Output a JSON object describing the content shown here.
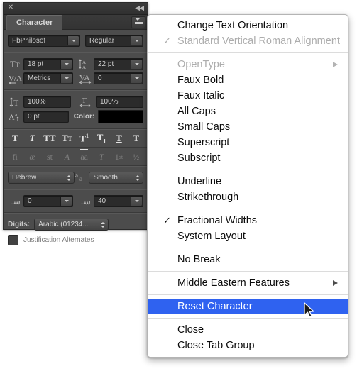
{
  "panel": {
    "title": "Character",
    "close_icon": "close-icon",
    "collapse_icon": "collapse-panel-icon",
    "menu_icon": "panel-menu-icon",
    "font": {
      "family": "FbPhilosof",
      "style": "Regular"
    },
    "size": {
      "icon": "font-size-icon",
      "value": "18 pt"
    },
    "leading": {
      "icon": "leading-icon",
      "value": "22 pt"
    },
    "kerning": {
      "icon": "kerning-icon",
      "value": "Metrics"
    },
    "tracking": {
      "icon": "tracking-icon",
      "value": "0"
    },
    "vertical_scale": {
      "icon": "vertical-scale-icon",
      "value": "100%"
    },
    "horizontal_scale": {
      "icon": "horizontal-scale-icon",
      "value": "100%"
    },
    "baseline_shift": {
      "icon": "baseline-shift-icon",
      "value": "0 pt"
    },
    "color": {
      "label": "Color:",
      "value": "#000000"
    },
    "style_buttons": [
      {
        "name": "faux-bold-button",
        "glyph": "T",
        "enabled": true
      },
      {
        "name": "faux-italic-button",
        "glyph": "T",
        "enabled": true
      },
      {
        "name": "all-caps-button",
        "glyph": "TT",
        "enabled": true
      },
      {
        "name": "small-caps-button",
        "glyph": "TT",
        "enabled": true
      },
      {
        "name": "superscript-button",
        "glyph": "T1",
        "enabled": true
      },
      {
        "name": "subscript-button",
        "glyph": "T1",
        "enabled": true
      },
      {
        "name": "underline-button",
        "glyph": "T",
        "enabled": true
      },
      {
        "name": "strikethrough-button",
        "glyph": "T",
        "enabled": true
      }
    ],
    "opentype_buttons": [
      {
        "name": "standard-ligatures-button",
        "glyph": "fi",
        "enabled": false
      },
      {
        "name": "contextual-alternates-button",
        "glyph": "œ",
        "enabled": false
      },
      {
        "name": "discretionary-ligatures-button",
        "glyph": "st",
        "enabled": false
      },
      {
        "name": "swash-button",
        "glyph": "A",
        "enabled": false
      },
      {
        "name": "stylistic-alternates-button",
        "glyph": "aa",
        "enabled": false
      },
      {
        "name": "titling-alternates-button",
        "glyph": "T",
        "enabled": false
      },
      {
        "name": "ordinals-button",
        "glyph": "1st",
        "enabled": false
      },
      {
        "name": "fractions-button",
        "glyph": "½",
        "enabled": false
      }
    ],
    "language": {
      "value": "Hebrew"
    },
    "antialias": {
      "icon": "anti-alias-icon",
      "value": "Smooth"
    },
    "kashida": {
      "icon": "kashida-icon",
      "value": "0"
    },
    "diacritic": {
      "icon": "diacritic-position-icon",
      "value": "40"
    },
    "digits": {
      "label": "Digits:",
      "value": "Arabic (01234..."
    },
    "justification_alternates": {
      "label": "Justification Alternates",
      "checked": false
    }
  },
  "menu": {
    "items": [
      {
        "label": "Change Text Orientation",
        "name": "menu-item-change-text-orientation",
        "disabled": false,
        "checked": false,
        "submenu": false
      },
      {
        "label": "Standard Vertical Roman Alignment",
        "name": "menu-item-standard-vertical-roman-alignment",
        "disabled": true,
        "checked": true,
        "submenu": false
      },
      {
        "separator": true
      },
      {
        "label": "OpenType",
        "name": "menu-item-opentype",
        "disabled": true,
        "checked": false,
        "submenu": true
      },
      {
        "label": "Faux Bold",
        "name": "menu-item-faux-bold",
        "disabled": false,
        "checked": false,
        "submenu": false
      },
      {
        "label": "Faux Italic",
        "name": "menu-item-faux-italic",
        "disabled": false,
        "checked": false,
        "submenu": false
      },
      {
        "label": "All Caps",
        "name": "menu-item-all-caps",
        "disabled": false,
        "checked": false,
        "submenu": false
      },
      {
        "label": "Small Caps",
        "name": "menu-item-small-caps",
        "disabled": false,
        "checked": false,
        "submenu": false
      },
      {
        "label": "Superscript",
        "name": "menu-item-superscript",
        "disabled": false,
        "checked": false,
        "submenu": false
      },
      {
        "label": "Subscript",
        "name": "menu-item-subscript",
        "disabled": false,
        "checked": false,
        "submenu": false
      },
      {
        "separator": true
      },
      {
        "label": "Underline",
        "name": "menu-item-underline",
        "disabled": false,
        "checked": false,
        "submenu": false
      },
      {
        "label": "Strikethrough",
        "name": "menu-item-strikethrough",
        "disabled": false,
        "checked": false,
        "submenu": false
      },
      {
        "separator": true
      },
      {
        "label": "Fractional Widths",
        "name": "menu-item-fractional-widths",
        "disabled": false,
        "checked": true,
        "submenu": false
      },
      {
        "label": "System Layout",
        "name": "menu-item-system-layout",
        "disabled": false,
        "checked": false,
        "submenu": false
      },
      {
        "separator": true
      },
      {
        "label": "No Break",
        "name": "menu-item-no-break",
        "disabled": false,
        "checked": false,
        "submenu": false
      },
      {
        "separator": true
      },
      {
        "label": "Middle Eastern Features",
        "name": "menu-item-middle-eastern-features",
        "disabled": false,
        "checked": false,
        "submenu": true
      },
      {
        "separator": true
      },
      {
        "label": "Reset Character",
        "name": "menu-item-reset-character",
        "disabled": false,
        "checked": false,
        "submenu": false,
        "selected": true
      },
      {
        "separator": true
      },
      {
        "label": "Close",
        "name": "menu-item-close",
        "disabled": false,
        "checked": false,
        "submenu": false
      },
      {
        "label": "Close Tab Group",
        "name": "menu-item-close-tab-group",
        "disabled": false,
        "checked": false,
        "submenu": false
      }
    ],
    "highlight_color": "#2f62f0",
    "check_glyph": "✓"
  },
  "cursor": {
    "name": "mouse-pointer"
  }
}
